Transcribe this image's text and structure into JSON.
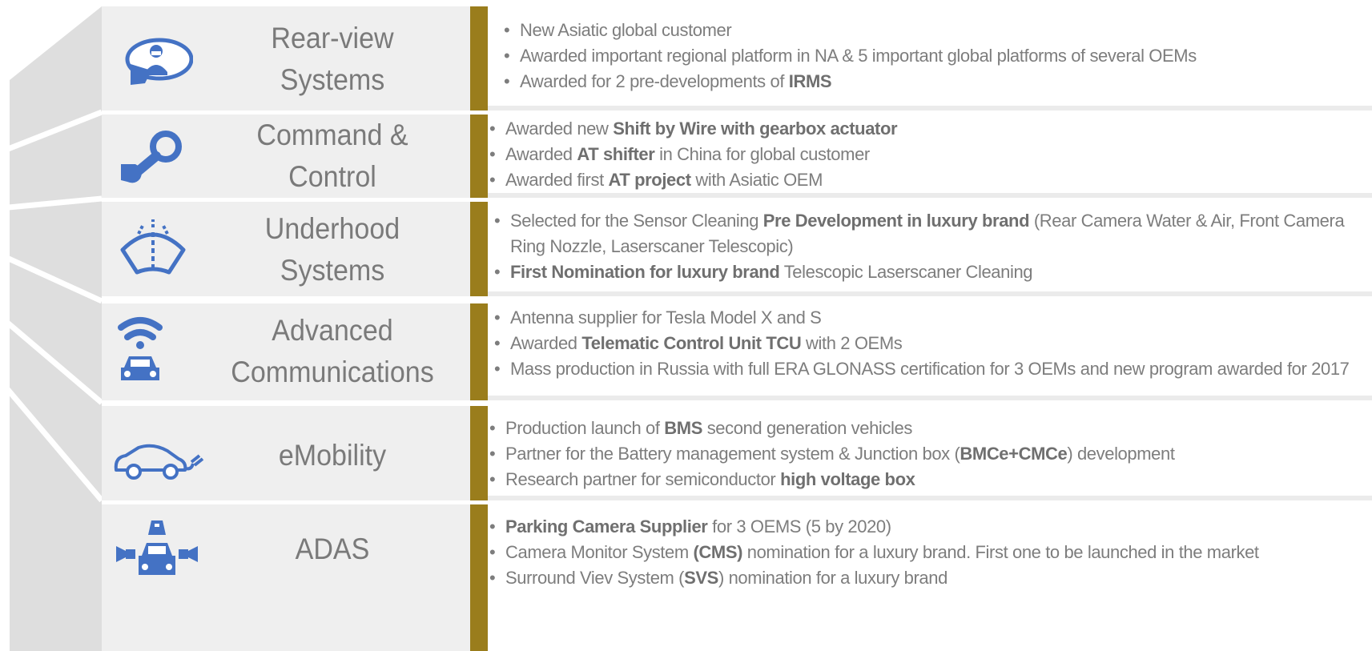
{
  "colors": {
    "accent_bar": "#9a7d1c",
    "label_background": "#efefef",
    "fan_background": "#dedede",
    "icon_blue": "#4472c4",
    "text_gray": "#7d7d7d"
  },
  "rows": [
    {
      "icon": "side-mirror-driver-icon",
      "title_lines": [
        "Rear-view",
        "Systems"
      ],
      "bullets": [
        [
          {
            "t": "New Asiatic global customer",
            "b": false
          }
        ],
        [
          {
            "t": "Awarded important regional platform in NA & 5 important global platforms of several OEMs",
            "b": false
          }
        ],
        [
          {
            "t": "Awarded for 2 pre-developments of ",
            "b": false
          },
          {
            "t": "IRMS",
            "b": true
          }
        ]
      ]
    },
    {
      "icon": "gear-shifter-icon",
      "title_lines": [
        "Command &",
        "Control"
      ],
      "bullets": [
        [
          {
            "t": "Awarded new ",
            "b": false
          },
          {
            "t": "Shift by Wire with gearbox actuator",
            "b": true
          }
        ],
        [
          {
            "t": "Awarded ",
            "b": false
          },
          {
            "t": "AT shifter",
            "b": true
          },
          {
            "t": " in China for global customer",
            "b": false
          }
        ],
        [
          {
            "t": "Awarded first ",
            "b": false
          },
          {
            "t": "AT project",
            "b": true
          },
          {
            "t": " with Asiatic OEM",
            "b": false
          }
        ]
      ]
    },
    {
      "icon": "windshield-washer-icon",
      "title_lines": [
        "Underhood",
        "Systems"
      ],
      "bullets": [
        [
          {
            "t": "Selected for the Sensor Cleaning ",
            "b": false
          },
          {
            "t": "Pre Development in luxury brand",
            "b": true
          },
          {
            "t": " (Rear Camera Water & Air, Front Camera Ring Nozzle, Laserscaner Telescopic)",
            "b": false
          }
        ],
        [
          {
            "t": "First Nomination for luxury brand",
            "b": true
          },
          {
            "t": " Telescopic Laserscaner Cleaning",
            "b": false
          }
        ]
      ]
    },
    {
      "icon": "connected-car-icon",
      "title_lines": [
        "Advanced",
        "Communications"
      ],
      "bullets": [
        [
          {
            "t": "Antenna supplier for Tesla Model X and S",
            "b": false
          }
        ],
        [
          {
            "t": "Awarded ",
            "b": false
          },
          {
            "t": "Telematic Control Unit TCU",
            "b": true
          },
          {
            "t": " with 2 OEMs",
            "b": false
          }
        ],
        [
          {
            "t": "Mass production in Russia with full ERA GLONASS certification for 3 OEMs and new program awarded for 2017",
            "b": false
          }
        ]
      ]
    },
    {
      "icon": "electric-car-plug-icon",
      "title_lines": [
        "eMobility"
      ],
      "bullets": [
        [
          {
            "t": "Production launch of ",
            "b": false
          },
          {
            "t": "BMS",
            "b": true
          },
          {
            "t": " second generation vehicles",
            "b": false
          }
        ],
        [
          {
            "t": "Partner for the Battery management system & Junction box (",
            "b": false
          },
          {
            "t": "BMCe+CMCe",
            "b": true
          },
          {
            "t": ") development",
            "b": false
          }
        ],
        [
          {
            "t": "Research partner for semiconductor ",
            "b": false
          },
          {
            "t": "high voltage box",
            "b": true
          }
        ]
      ]
    },
    {
      "icon": "car-cameras-icon",
      "title_lines": [
        "ADAS"
      ],
      "bullets": [
        [
          {
            "t": "Parking Camera Supplier",
            "b": true
          },
          {
            "t": " for 3 OEMS (5 by 2020)",
            "b": false
          }
        ],
        [
          {
            "t": "Camera Monitor System ",
            "b": false
          },
          {
            "t": "(CMS)",
            "b": true
          },
          {
            "t": " nomination for a luxury brand. First one to be launched in the market",
            "b": false
          }
        ],
        [
          {
            "t": "Surround Viev System (",
            "b": false
          },
          {
            "t": "SVS",
            "b": true
          },
          {
            "t": ") nomination for a luxury brand",
            "b": false
          }
        ]
      ]
    }
  ]
}
